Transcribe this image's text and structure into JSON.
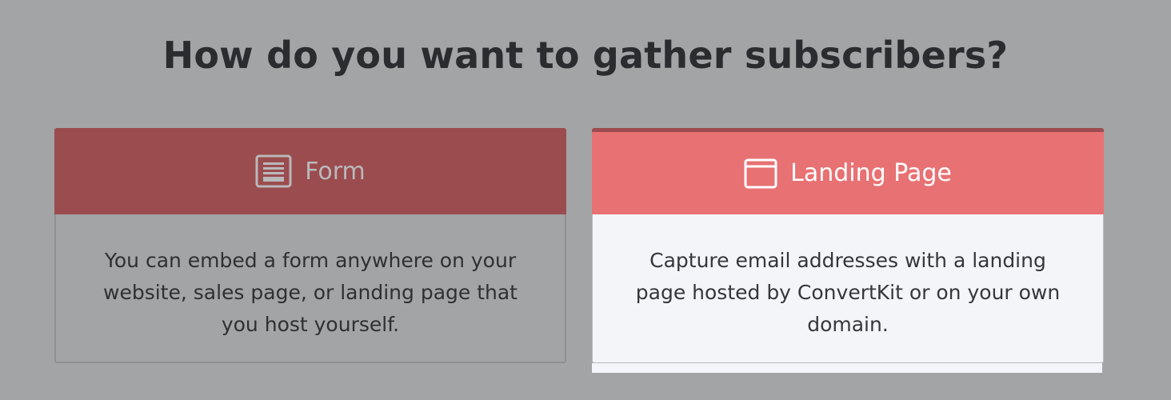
{
  "page": {
    "title": "How do you want to gather subscribers?"
  },
  "options": [
    {
      "label": "Form",
      "icon": "form-icon",
      "description": "You can embed a form anywhere on your website, sales page, or landing page that you host yourself.",
      "selected": false
    },
    {
      "label": "Landing Page",
      "icon": "browser-window-icon",
      "description": "Capture email addresses with a landing page hosted by ConvertKit or on your own domain.",
      "selected": true
    }
  ],
  "colors": {
    "background": "#a3a4a6",
    "accent": "#e87173",
    "accent_dark": "#9b4c4e",
    "selected_body": "#f4f5f9"
  }
}
